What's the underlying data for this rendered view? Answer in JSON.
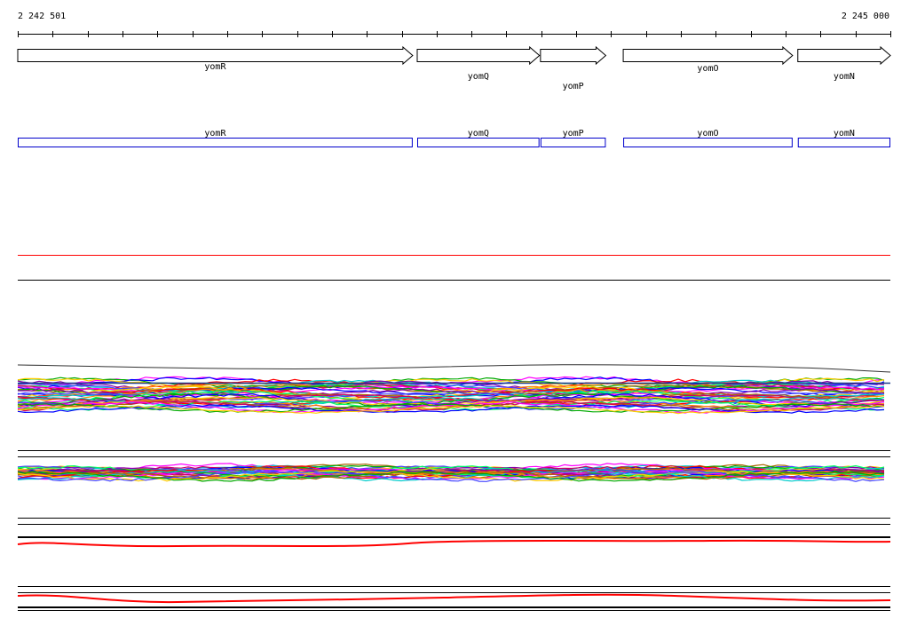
{
  "region": {
    "start_label": "2 242 501",
    "end_label": "2 245 000",
    "start": 2242501,
    "end": 2245000
  },
  "genes": [
    {
      "name": "yomR",
      "start": 2242501,
      "end": 2243632,
      "strand": "+"
    },
    {
      "name": "yomQ",
      "start": 2243645,
      "end": 2243995,
      "strand": "+"
    },
    {
      "name": "yomP",
      "start": 2243998,
      "end": 2244185,
      "strand": "+"
    },
    {
      "name": "yomO",
      "start": 2244235,
      "end": 2244720,
      "strand": "+"
    },
    {
      "name": "yomN",
      "start": 2244735,
      "end": 2245000,
      "strand": "+"
    }
  ],
  "colors": {
    "gene_outline": "#000000",
    "feature_box": "#0000cc",
    "red_track": "#ff0000",
    "axis": "#000000"
  }
}
